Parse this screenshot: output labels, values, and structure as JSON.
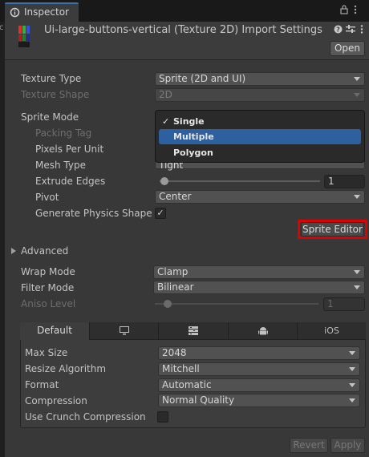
{
  "window": {
    "tab_label": "Inspector",
    "title": "Ui-large-buttons-vertical (Texture 2D) Import Settings",
    "open_label": "Open",
    "left_clip_text": "c"
  },
  "icons": [
    "inspector-icon",
    "lock-icon",
    "menu-icon",
    "help-icon",
    "preset-icon",
    "more-icon",
    "texture-thumbnail-icon",
    "monitor-icon",
    "webgl-icon",
    "android-icon"
  ],
  "fields": {
    "texture_type": {
      "label": "Texture Type",
      "value": "Sprite (2D and UI)"
    },
    "texture_shape": {
      "label": "Texture Shape",
      "value": "2D"
    },
    "sprite_mode": {
      "label": "Sprite Mode",
      "value": "Single"
    },
    "packing_tag": {
      "label": "Packing Tag"
    },
    "pixels_per_unit": {
      "label": "Pixels Per Unit"
    },
    "mesh_type": {
      "label": "Mesh Type",
      "value": "Tight"
    },
    "extrude_edges": {
      "label": "Extrude Edges",
      "value": "1"
    },
    "pivot": {
      "label": "Pivot",
      "value": "Center"
    },
    "generate_physics_shape": {
      "label": "Generate Physics Shape",
      "checked": true,
      "check_glyph": "✓"
    },
    "sprite_editor_label": "Sprite Editor",
    "advanced_label": "Advanced",
    "wrap_mode": {
      "label": "Wrap Mode",
      "value": "Clamp"
    },
    "filter_mode": {
      "label": "Filter Mode",
      "value": "Bilinear"
    },
    "aniso_level": {
      "label": "Aniso Level",
      "value": "1"
    }
  },
  "sprite_mode_popup": {
    "options": [
      {
        "label": "Single",
        "checked": true,
        "check_glyph": "✓"
      },
      {
        "label": "Multiple",
        "highlighted": true
      },
      {
        "label": "Polygon"
      }
    ]
  },
  "platform": {
    "tabs": [
      {
        "label": "Default",
        "active": true
      },
      {
        "label": "",
        "icon": "monitor-icon"
      },
      {
        "label": "",
        "icon": "webgl-icon"
      },
      {
        "label": "",
        "icon": "android-icon"
      },
      {
        "label": "iOS"
      }
    ],
    "max_size": {
      "label": "Max Size",
      "value": "2048"
    },
    "resize_algorithm": {
      "label": "Resize Algorithm",
      "value": "Mitchell"
    },
    "format": {
      "label": "Format",
      "value": "Automatic"
    },
    "compression": {
      "label": "Compression",
      "value": "Normal Quality"
    },
    "use_crunch": {
      "label": "Use Crunch Compression",
      "checked": false
    }
  },
  "footer": {
    "revert_label": "Revert",
    "apply_label": "Apply"
  },
  "colors": {
    "accent": "#2e5f9f",
    "highlight_border": "#e00000",
    "panel": "#383838"
  }
}
